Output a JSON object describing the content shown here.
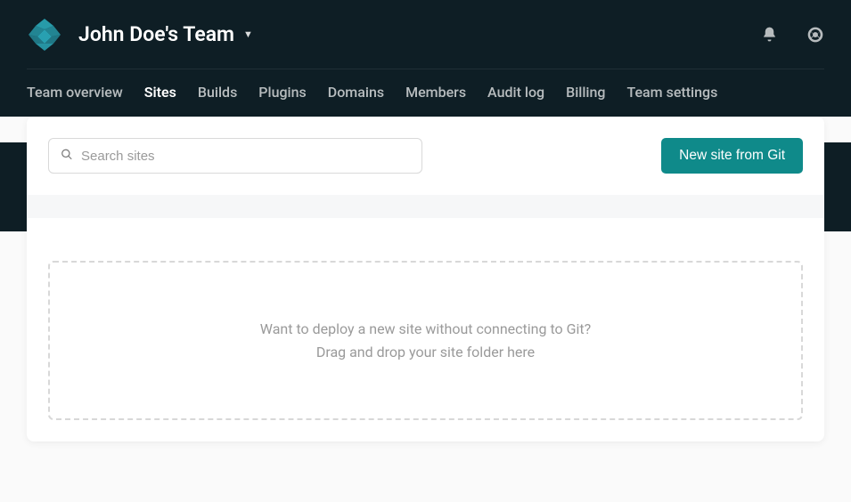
{
  "header": {
    "team_name": "John Doe's Team"
  },
  "nav": {
    "tabs": [
      {
        "label": "Team overview",
        "active": false
      },
      {
        "label": "Sites",
        "active": true
      },
      {
        "label": "Builds",
        "active": false
      },
      {
        "label": "Plugins",
        "active": false
      },
      {
        "label": "Domains",
        "active": false
      },
      {
        "label": "Members",
        "active": false
      },
      {
        "label": "Audit log",
        "active": false
      },
      {
        "label": "Billing",
        "active": false
      },
      {
        "label": "Team settings",
        "active": false
      }
    ]
  },
  "search": {
    "placeholder": "Search sites"
  },
  "actions": {
    "new_site_label": "New site from Git"
  },
  "dropzone": {
    "line1": "Want to deploy a new site without connecting to Git?",
    "line2": "Drag and drop your site folder here"
  }
}
